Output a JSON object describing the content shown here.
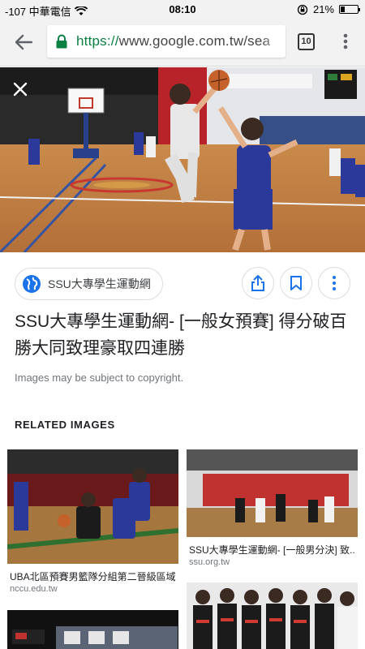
{
  "status_bar": {
    "carrier": "-107 中華電信",
    "time": "08:10",
    "battery": "21%",
    "battery_level": 0.21
  },
  "browser": {
    "url_scheme": "https://",
    "url_rest": "www.google.com.tw/sea",
    "tab_count": "10"
  },
  "colors": {
    "secure_green": "#0b8043",
    "accent_blue": "#1a73e8",
    "jersey_blue": "#2b3a9a"
  },
  "source": {
    "label": "SSU大專學生運動網"
  },
  "result": {
    "title": "SSU大專學生運動網- [一般女預賽] 得分破百勝大同致理豪取四連勝",
    "copyright_note": "Images may be subject to copyright."
  },
  "related": {
    "heading": "RELATED IMAGES",
    "items": [
      {
        "caption": "UBA北區預賽男籃隊分組第二晉級區域...",
        "domain": "nccu.edu.tw"
      },
      {
        "caption": "SSU大專學生運動網- [一般男分決] 致...",
        "domain": "ssu.org.tw"
      },
      {
        "caption": "",
        "domain": ""
      },
      {
        "caption": "",
        "domain": ""
      }
    ]
  },
  "icons": {
    "back": "arrow-left",
    "lock": "lock",
    "overflow_menu": "more-vertical",
    "close": "close",
    "source": "globe",
    "share": "share",
    "save": "bookmark",
    "more": "more-vertical"
  }
}
